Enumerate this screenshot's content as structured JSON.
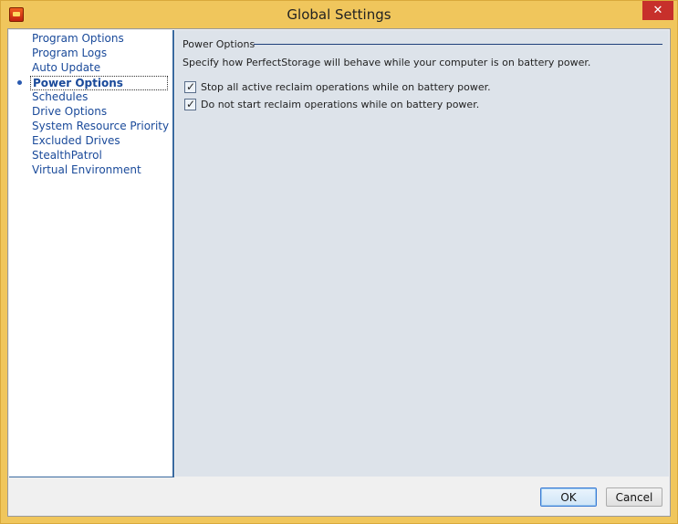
{
  "window": {
    "title": "Global Settings",
    "close_label": "✕"
  },
  "nav": {
    "items": [
      {
        "label": "Program Options"
      },
      {
        "label": "Program Logs"
      },
      {
        "label": "Auto Update"
      },
      {
        "label": "Power Options",
        "selected": true
      },
      {
        "label": "Schedules"
      },
      {
        "label": "Drive Options"
      },
      {
        "label": "System Resource Priority"
      },
      {
        "label": "Excluded Drives"
      },
      {
        "label": "StealthPatrol"
      },
      {
        "label": "Virtual Environment"
      }
    ]
  },
  "content": {
    "section_title": "Power Options",
    "description": "Specify how PerfectStorage will behave while your computer is on battery power.",
    "options": [
      {
        "label": "Stop all active reclaim operations while on battery power.",
        "checked": true
      },
      {
        "label": "Do not start reclaim operations while on battery power.",
        "checked": true
      }
    ]
  },
  "buttons": {
    "ok": "OK",
    "cancel": "Cancel"
  },
  "colors": {
    "title_bar": "#f0c65c",
    "close_button": "#c7302b",
    "nav_link": "#1a4a9a",
    "content_bg": "#dde3ea"
  }
}
